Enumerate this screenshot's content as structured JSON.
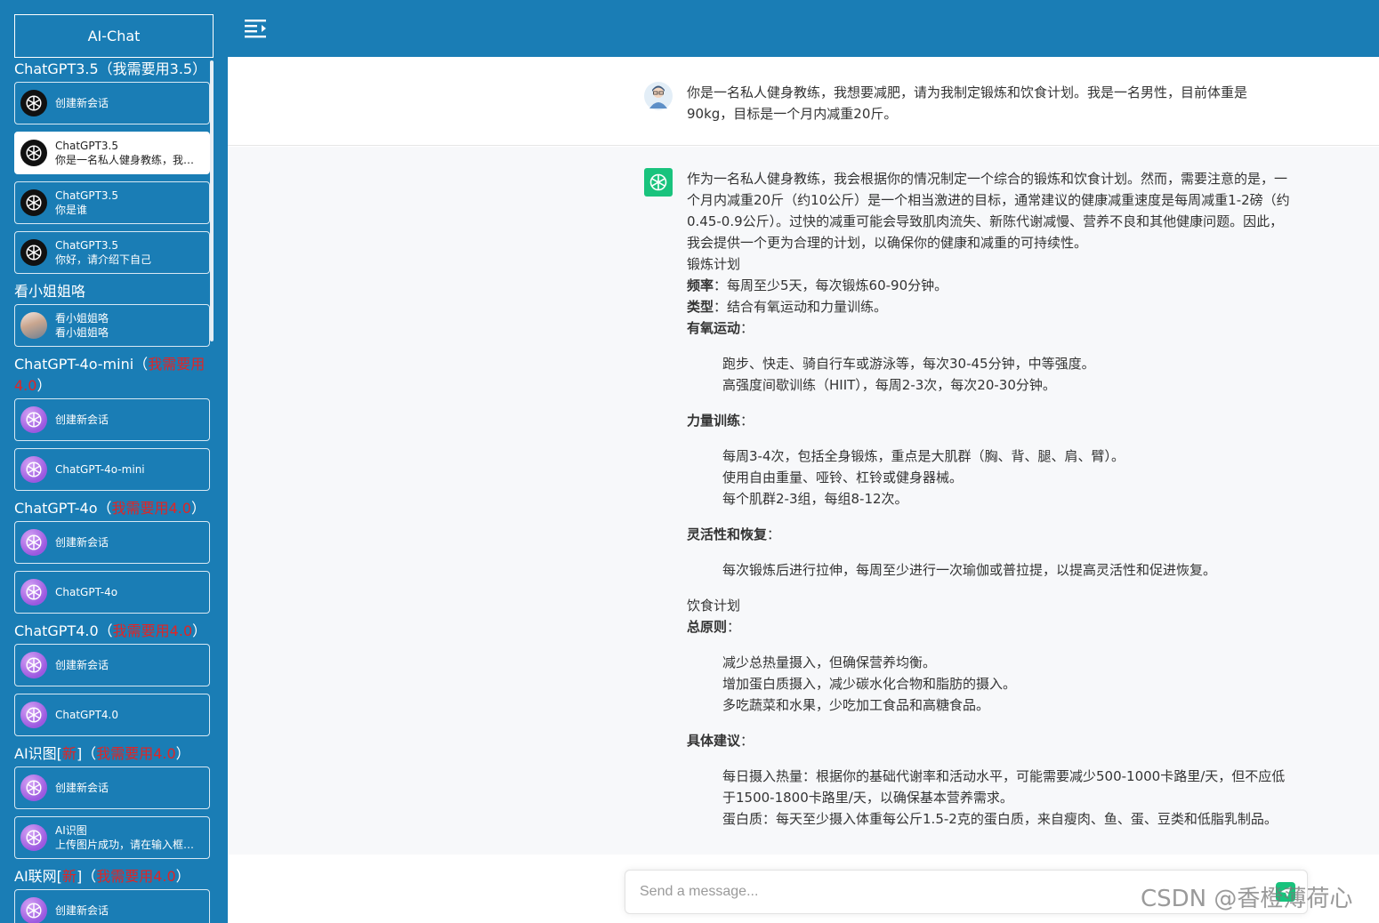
{
  "app": {
    "title": "AI-Chat"
  },
  "sidebar": {
    "groups": [
      {
        "title": "ChatGPT3.5（我需要用3.5）",
        "title_plain": "ChatGPT3.5（我需要用3.5）",
        "red": "",
        "items": [
          {
            "icon": "openai-icon",
            "title": "创建新会话",
            "subtitle": ""
          },
          {
            "icon": "openai-icon",
            "title": "ChatGPT3.5",
            "subtitle": "你是一名私人健身教练，我想要减肥",
            "active": true
          },
          {
            "icon": "openai-icon",
            "title": "ChatGPT3.5",
            "subtitle": "你是谁"
          },
          {
            "icon": "openai-icon",
            "title": "ChatGPT3.5",
            "subtitle": "你好，请介绍下自己"
          }
        ]
      },
      {
        "title": "看小姐姐咯",
        "items": [
          {
            "icon": "girl-photo-icon",
            "title": "看小姐姐咯",
            "subtitle": "看小姐姐咯"
          }
        ]
      },
      {
        "title": "ChatGPT-4o-mini（",
        "red": "我需要用4.0",
        "suffix": "）",
        "items": [
          {
            "icon": "openai-purple-icon",
            "title": "创建新会话",
            "subtitle": ""
          },
          {
            "icon": "openai-purple-icon",
            "title": "ChatGPT-4o-mini",
            "subtitle": ""
          }
        ]
      },
      {
        "title": "ChatGPT-4o（",
        "red": "我需要用4.0",
        "suffix": "）",
        "items": [
          {
            "icon": "openai-purple-icon",
            "title": "创建新会话",
            "subtitle": ""
          },
          {
            "icon": "openai-purple-icon",
            "title": "ChatGPT-4o",
            "subtitle": ""
          }
        ]
      },
      {
        "title": "ChatGPT4.0（",
        "red": "我需要用4.0",
        "suffix": "）",
        "items": [
          {
            "icon": "openai-purple-icon",
            "title": "创建新会话",
            "subtitle": ""
          },
          {
            "icon": "openai-purple-icon",
            "title": "ChatGPT4.0",
            "subtitle": ""
          }
        ]
      },
      {
        "title": "AI识图[",
        "red_new": "新",
        "mid": "]（",
        "red": "我需要用4.0",
        "suffix": "）",
        "items": [
          {
            "icon": "openai-purple-icon",
            "title": "创建新会话",
            "subtitle": ""
          },
          {
            "icon": "openai-purple-icon",
            "title": "AI识图",
            "subtitle": "上传图片成功，请在输入框输入问题"
          }
        ]
      },
      {
        "title": "AI联网[",
        "red_new": "新",
        "mid": "]（",
        "red": "我需要用4.0",
        "suffix": "）",
        "items": [
          {
            "icon": "openai-purple-icon",
            "title": "创建新会话",
            "subtitle": ""
          }
        ]
      }
    ]
  },
  "chat": {
    "user_message": "你是一名私人健身教练，我想要减肥，请为我制定锻炼和饮食计划。我是一名男性，目前体重是90kg，目标是一个月内减重20斤。",
    "assistant": {
      "intro": "作为一名私人健身教练，我会根据你的情况制定一个综合的锻炼和饮食计划。然而，需要注意的是，一个月内减重20斤（约10公斤）是一个相当激进的目标，通常建议的健康减重速度是每周减重1-2磅（约0.45-0.9公斤）。过快的减重可能会导致肌肉流失、新陈代谢减慢、营养不良和其他健康问题。因此，我会提供一个更为合理的计划，以确保你的健康和减重的可持续性。",
      "exercise_title": "锻炼计划",
      "freq_label": "频率",
      "freq_text": "：每周至少5天，每次锻炼60-90分钟。",
      "type_label": "类型",
      "type_text": "：结合有氧运动和力量训练。",
      "aerobic_label": "有氧运动",
      "aerobic_items": [
        "跑步、快走、骑自行车或游泳等，每次30-45分钟，中等强度。",
        "高强度间歇训练（HIIT），每周2-3次，每次20-30分钟。"
      ],
      "strength_label": "力量训练",
      "strength_items": [
        "每周3-4次，包括全身锻炼，重点是大肌群（胸、背、腿、肩、臂）。",
        "使用自由重量、哑铃、杠铃或健身器械。",
        "每个肌群2-3组，每组8-12次。"
      ],
      "flex_label": "灵活性和恢复",
      "flex_items": [
        "每次锻炼后进行拉伸，每周至少进行一次瑜伽或普拉提，以提高灵活性和促进恢复。"
      ],
      "diet_title": "饮食计划",
      "principle_label": "总原则",
      "principle_items": [
        "减少总热量摄入，但确保营养均衡。",
        "增加蛋白质摄入，减少碳水化合物和脂肪的摄入。",
        "多吃蔬菜和水果，少吃加工食品和高糖食品。"
      ],
      "advice_label": "具体建议",
      "advice_items": [
        "每日摄入热量：根据你的基础代谢率和活动水平，可能需要减少500-1000卡路里/天，但不应低于1500-1800卡路里/天，以确保基本营养需求。",
        "蛋白质：每天至少摄入体重每公斤1.5-2克的蛋白质，来自瘦肉、鱼、蛋、豆类和低脂乳制品。"
      ],
      "colon": "："
    }
  },
  "input": {
    "placeholder": "Send a message..."
  },
  "watermark": "CSDN @香橙薄荷心",
  "colors": {
    "sidebar": "#1a7db5",
    "accent": "#19c37d",
    "warn": "#e22424"
  }
}
